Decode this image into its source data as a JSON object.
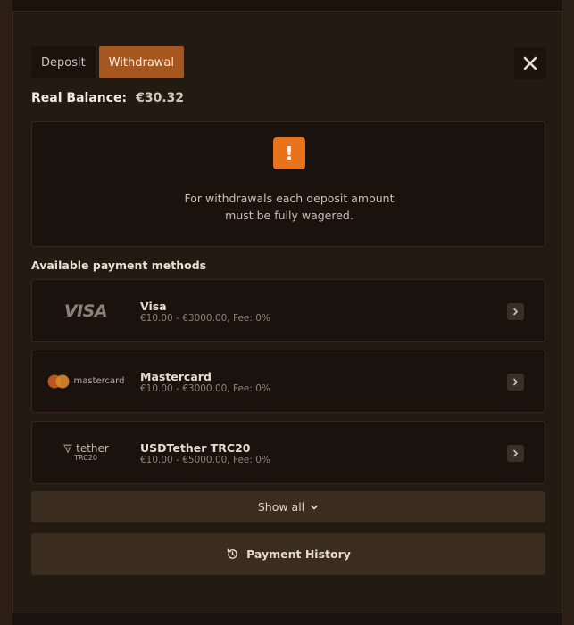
{
  "tabs": [
    {
      "label": "Deposit",
      "active": false
    },
    {
      "label": "Withdrawal",
      "active": true
    }
  ],
  "close_icon": "close-icon",
  "balance": {
    "label": "Real Balance:",
    "value": "€30.32"
  },
  "notice": {
    "icon": "exclamation-icon",
    "line1": "For withdrawals each deposit amount",
    "line2": "must be fully wagered."
  },
  "payment_methods": {
    "title": "Available payment methods",
    "items": [
      {
        "name": "Visa",
        "range": "€10.00 - €3000.00, Fee: 0%",
        "logo_text": "VISA"
      },
      {
        "name": "Mastercard",
        "range": "€10.00 - €3000.00, Fee: 0%",
        "logo_text": "mastercard"
      },
      {
        "name": "USDTether TRC20",
        "range": "€10.00 - €5000.00, Fee: 0%",
        "logo_text": "tether",
        "logo_sub": "TRC20"
      }
    ]
  },
  "show_all": {
    "label": "Show all",
    "icon": "chevron-down-icon"
  },
  "payment_history": {
    "label": "Payment History",
    "icon": "history-icon"
  },
  "colors": {
    "accent": "#a6561f",
    "warning": "#e8731b",
    "background": "#231a12",
    "card": "#1a130d"
  }
}
